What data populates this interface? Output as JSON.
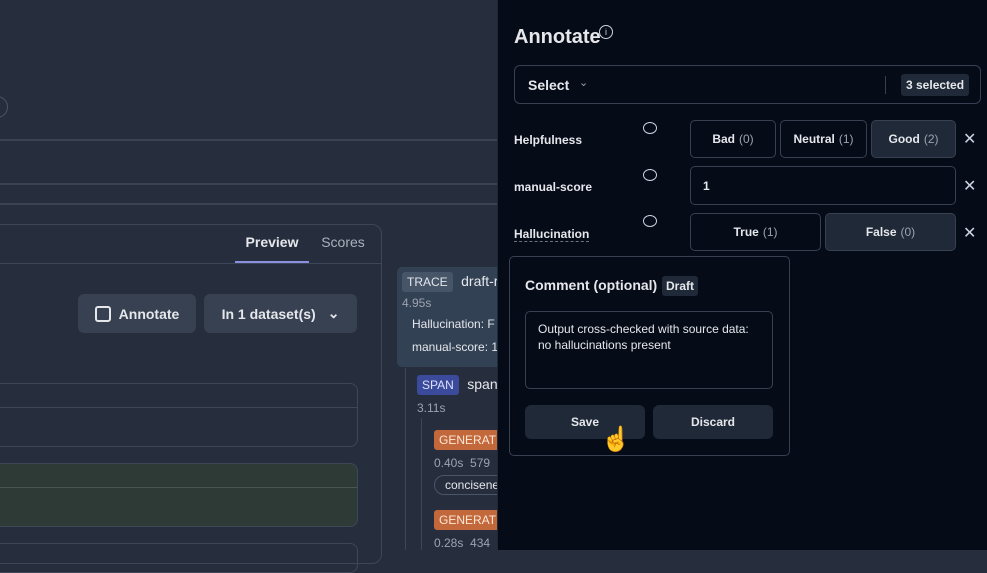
{
  "tabs": [
    {
      "label": "Preview",
      "active": true
    },
    {
      "label": "Scores",
      "active": false
    }
  ],
  "actions": {
    "annotate_label": "Annotate",
    "dataset_label": "In 1 dataset(s)"
  },
  "trace": {
    "root": {
      "type": "TRACE",
      "name": "draft-r",
      "duration": "4.95s",
      "scores": [
        "Hallucination: F",
        "manual-score: 1"
      ]
    },
    "span": {
      "type": "SPAN",
      "name": "span-",
      "duration": "3.11s"
    },
    "generations": [
      {
        "type": "GENERATIO",
        "duration": "0.40s",
        "tokens": "579",
        "score": "concisene"
      },
      {
        "type": "GENERATIO",
        "duration": "0.28s",
        "tokens": "434"
      }
    ]
  },
  "annotate": {
    "title": "Annotate",
    "select_label": "Select",
    "selected_badge": "3 selected",
    "rows": [
      {
        "label": "Helpfulness",
        "options": [
          {
            "label": "Bad",
            "count": "(0)"
          },
          {
            "label": "Neutral",
            "count": "(1)"
          },
          {
            "label": "Good",
            "count": "(2)",
            "selected": true
          }
        ]
      },
      {
        "label": "manual-score",
        "value": "1"
      },
      {
        "label": "Hallucination",
        "options": [
          {
            "label": "True",
            "count": "(1)"
          },
          {
            "label": "False",
            "count": "(0)",
            "selected": true
          }
        ]
      }
    ],
    "comment": {
      "title": "Comment (optional)",
      "badge": "Draft",
      "text": "Output cross-checked with source data: no hallucinations present",
      "save": "Save",
      "discard": "Discard"
    }
  },
  "colors": {
    "accent": "#8b8fe0",
    "trace": "#475569",
    "span": "#3b4a9a",
    "generation": "#c2683a"
  }
}
